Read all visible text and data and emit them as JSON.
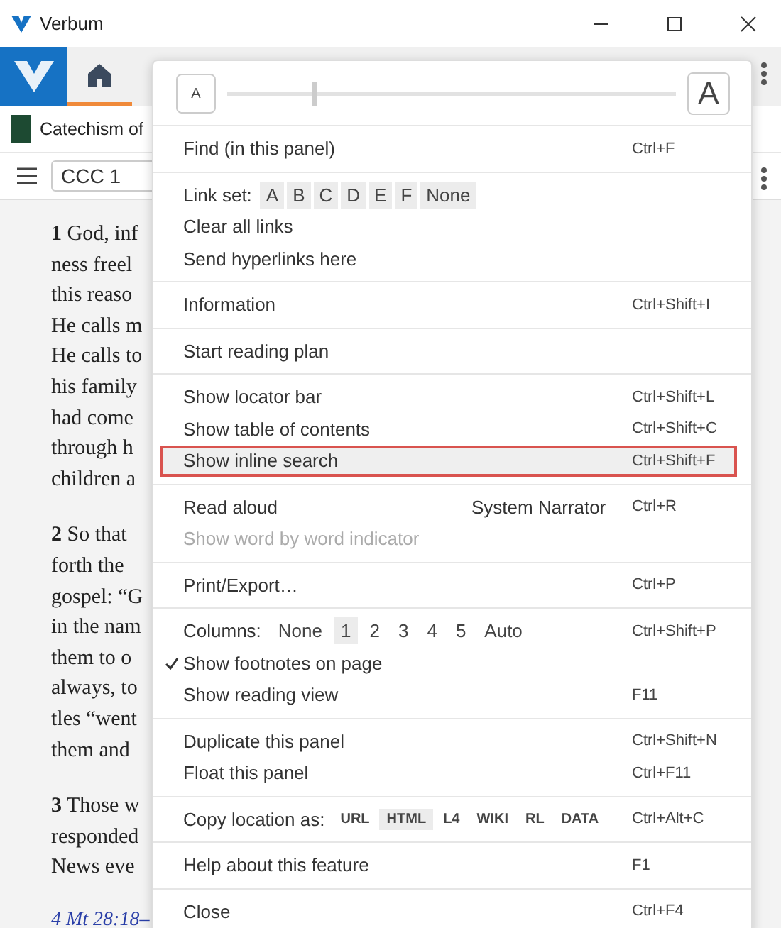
{
  "window": {
    "title": "Verbum"
  },
  "panel": {
    "title": "Catechism of",
    "locator": "CCC 1"
  },
  "document": {
    "paragraphs": [
      {
        "lines": [
          "**1** God, inf",
          "ness freel",
          "this reaso",
          "He calls m",
          "He calls to",
          "his family",
          "had come",
          "through h",
          "children a"
        ]
      },
      {
        "lines": [
          "**2** So that",
          "forth the",
          "gospel: “G",
          "in the nam",
          "them to o",
          "always, to",
          "tles “went",
          "them and"
        ]
      },
      {
        "lines": [
          "**3** Those w",
          "responded",
          "News eve"
        ]
      }
    ],
    "footnote": "4 Mt 28:18–"
  },
  "menu": {
    "font_size": {
      "small": "A",
      "large": "A",
      "level": 0.19
    },
    "sections": [
      {
        "items": [
          {
            "kind": "command",
            "label": "Find (in this panel)",
            "shortcut": "Ctrl+F"
          }
        ]
      },
      {
        "items": [
          {
            "kind": "linkset",
            "label": "Link set:",
            "options": [
              "A",
              "B",
              "C",
              "D",
              "E",
              "F",
              "None"
            ]
          },
          {
            "kind": "command",
            "label": "Clear all links"
          },
          {
            "kind": "command",
            "label": "Send hyperlinks here"
          }
        ]
      },
      {
        "items": [
          {
            "kind": "command",
            "label": "Information",
            "shortcut": "Ctrl+Shift+I"
          }
        ]
      },
      {
        "items": [
          {
            "kind": "command",
            "label": "Start reading plan"
          }
        ]
      },
      {
        "items": [
          {
            "kind": "command",
            "label": "Show locator bar",
            "shortcut": "Ctrl+Shift+L"
          },
          {
            "kind": "command",
            "label": "Show table of contents",
            "shortcut": "Ctrl+Shift+C"
          },
          {
            "kind": "command",
            "label": "Show inline search",
            "shortcut": "Ctrl+Shift+F",
            "highlighted": true
          }
        ]
      },
      {
        "items": [
          {
            "kind": "command",
            "label": "Read aloud",
            "value": "System Narrator",
            "shortcut": "Ctrl+R"
          },
          {
            "kind": "command",
            "label": "Show word by word indicator",
            "disabled": true
          }
        ]
      },
      {
        "items": [
          {
            "kind": "command",
            "label": "Print/Export…",
            "shortcut": "Ctrl+P"
          }
        ]
      },
      {
        "items": [
          {
            "kind": "choice",
            "label": "Columns:",
            "shortcut": "Ctrl+Shift+P",
            "options": [
              {
                "label": "None",
                "selected": false
              },
              {
                "label": "1",
                "selected": true
              },
              {
                "label": "2",
                "selected": false
              },
              {
                "label": "3",
                "selected": false
              },
              {
                "label": "4",
                "selected": false
              },
              {
                "label": "5",
                "selected": false
              },
              {
                "label": "Auto",
                "selected": false
              }
            ]
          },
          {
            "kind": "command",
            "label": "Show footnotes on page",
            "checked": true
          },
          {
            "kind": "command",
            "label": "Show reading view",
            "shortcut": "F11"
          }
        ]
      },
      {
        "items": [
          {
            "kind": "command",
            "label": "Duplicate this panel",
            "shortcut": "Ctrl+Shift+N"
          },
          {
            "kind": "command",
            "label": "Float this panel",
            "shortcut": "Ctrl+F11"
          }
        ]
      },
      {
        "items": [
          {
            "kind": "choice",
            "small": true,
            "label": "Copy location as:",
            "shortcut": "Ctrl+Alt+C",
            "options": [
              {
                "label": "URL",
                "selected": false
              },
              {
                "label": "HTML",
                "selected": true
              },
              {
                "label": "L4",
                "selected": false
              },
              {
                "label": "WIKI",
                "selected": false
              },
              {
                "label": "RL",
                "selected": false
              },
              {
                "label": "DATA",
                "selected": false
              }
            ]
          }
        ]
      },
      {
        "items": [
          {
            "kind": "command",
            "label": "Help about this feature",
            "shortcut": "F1"
          }
        ]
      },
      {
        "items": [
          {
            "kind": "command",
            "label": "Close",
            "shortcut": "Ctrl+F4"
          }
        ]
      }
    ]
  }
}
